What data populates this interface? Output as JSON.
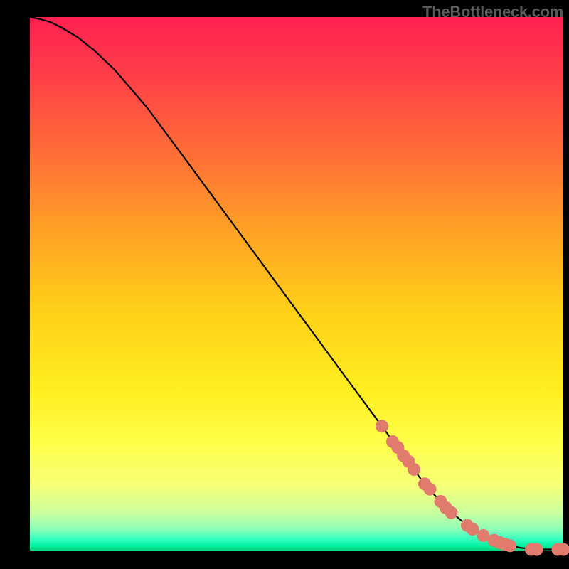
{
  "watermark": "TheBottleneck.com",
  "chart_data": {
    "type": "line",
    "title": "",
    "xlabel": "",
    "ylabel": "",
    "xlim": [
      0,
      100
    ],
    "ylim": [
      0,
      100
    ],
    "curve": {
      "name": "main-curve",
      "x": [
        0,
        2,
        4,
        6,
        9,
        12,
        16,
        22,
        30,
        40,
        50,
        60,
        66,
        70,
        74,
        78,
        82,
        86,
        88,
        90,
        92,
        95,
        100
      ],
      "y": [
        100,
        99.6,
        99.0,
        98.0,
        96.2,
        93.8,
        90.0,
        83.0,
        72.2,
        58.6,
        45.0,
        31.4,
        23.3,
        17.8,
        12.5,
        8.0,
        4.7,
        2.3,
        1.5,
        0.9,
        0.5,
        0.2,
        0.2
      ]
    },
    "scatter": {
      "name": "scatter-points",
      "color": "#e07b6d",
      "radius_px": 9,
      "points": [
        {
          "x": 66,
          "y": 23.3
        },
        {
          "x": 68,
          "y": 20.4
        },
        {
          "x": 69,
          "y": 19.3
        },
        {
          "x": 70,
          "y": 17.8
        },
        {
          "x": 71,
          "y": 16.7
        },
        {
          "x": 72,
          "y": 15.2
        },
        {
          "x": 74,
          "y": 12.5
        },
        {
          "x": 75,
          "y": 11.5
        },
        {
          "x": 77,
          "y": 9.2
        },
        {
          "x": 78,
          "y": 8.0
        },
        {
          "x": 79,
          "y": 7.1
        },
        {
          "x": 82,
          "y": 4.7
        },
        {
          "x": 83,
          "y": 4.0
        },
        {
          "x": 85,
          "y": 2.8
        },
        {
          "x": 87,
          "y": 1.9
        },
        {
          "x": 88,
          "y": 1.5
        },
        {
          "x": 89,
          "y": 1.2
        },
        {
          "x": 90,
          "y": 0.9
        },
        {
          "x": 94,
          "y": 0.2
        },
        {
          "x": 95,
          "y": 0.2
        },
        {
          "x": 99,
          "y": 0.2
        },
        {
          "x": 100,
          "y": 0.2
        }
      ]
    }
  }
}
